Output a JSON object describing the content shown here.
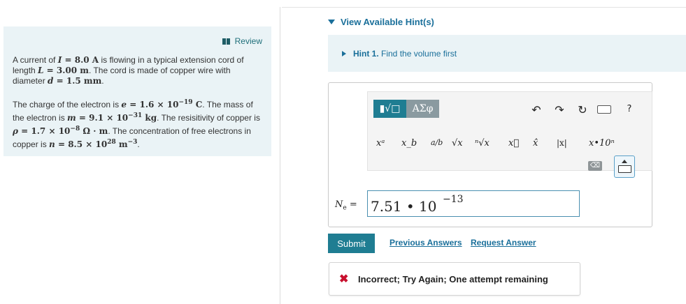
{
  "review": {
    "label": "Review"
  },
  "problem": {
    "p1": {
      "t1": "A current of ",
      "I_sym": "I",
      "eq1": " = ",
      "I_val": "8.0 A",
      "t2": " is flowing in a typical extension cord of length ",
      "L_sym": "L",
      "eq2": " = ",
      "L_val": "3.00 m",
      "t3": ". The cord is made of copper wire with diameter ",
      "d_sym": "d",
      "eq3": " = ",
      "d_val": "1.5 mm",
      "t4": "."
    },
    "p2": {
      "t1": "The charge of the electron is ",
      "e_sym": "e",
      "eq": " = ",
      "e_mant": "1.6 × 10",
      "e_exp": "−19",
      "e_unit": " C",
      "t2": ". The mass of the electron is ",
      "m_sym": "m",
      "m_mant": "9.1 × 10",
      "m_exp": "−31",
      "m_unit": " kg",
      "t3": ". The resisitivity of copper is ",
      "rho_sym": "ρ",
      "rho_mant": "1.7 × 10",
      "rho_exp": "−8",
      "rho_unit": " Ω · m",
      "t4": ". The concentration of free electrons in copper is ",
      "n_sym": "n",
      "n_mant": "8.5 × 10",
      "n_exp": "28",
      "n_unit": " m",
      "n_unit_exp": "−3",
      "t5": "."
    }
  },
  "hints": {
    "toggle_label": "View Available Hint(s)",
    "hint1_prefix": "Hint 1.",
    "hint1_text": "Find the volume first"
  },
  "toolbar": {
    "templates_label": "▮√□",
    "greek_label": "ΑΣφ",
    "undo_icon": "↶",
    "redo_icon": "↷",
    "reset_icon": "↻",
    "help_label": "?",
    "t_power": "xᵃ",
    "t_sub": "x_b",
    "t_frac": "a/b",
    "t_sqrt": "√x",
    "t_nroot": "ⁿ√x",
    "t_vec": "x⃗",
    "t_hat": "x̂",
    "t_abs": "|x|",
    "t_sci": "x•10ⁿ",
    "backspace": "⌫"
  },
  "answer": {
    "label_sym": "N",
    "label_sub": "e",
    "label_eq": " =",
    "value": "7.51 • 10",
    "exponent": "−13"
  },
  "actions": {
    "submit": "Submit",
    "previous": "Previous Answers",
    "request": "Request Answer"
  },
  "feedback": {
    "icon": "✖",
    "text": "Incorrect; Try Again; One attempt remaining"
  },
  "colors": {
    "accent": "#1f7d92",
    "link": "#1a6f9a",
    "panel_bg": "#eaf3f6",
    "error": "#c8102e"
  }
}
